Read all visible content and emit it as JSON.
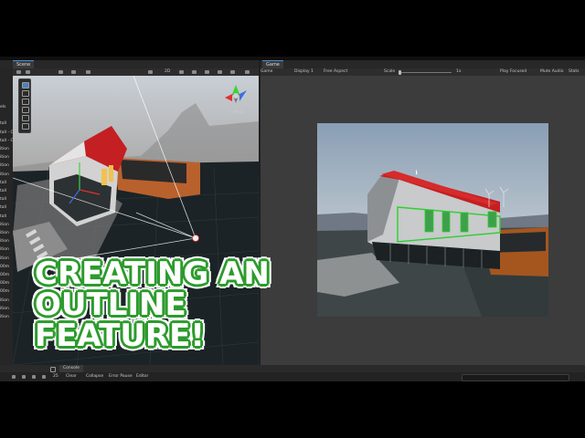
{
  "scene_tab": {
    "label": "Scene"
  },
  "game_tab": {
    "label": "Game"
  },
  "game_toolbar": {
    "mode": "Game",
    "display": "Display 1",
    "aspect": "Free Aspect",
    "scale_label": "Scale",
    "scale_value": "1x",
    "play_focused": "Play Focused",
    "mute_audio": "Mute Audio",
    "stats": "Stats"
  },
  "scene_toolbar": {
    "view_mode": "2D"
  },
  "gizmo": {
    "persp_label": "< Persp"
  },
  "hierarchy": {
    "items": [
      "els",
      "",
      "tall",
      "tall - Cu",
      "tall - Cu",
      "ition",
      "ition",
      "ition",
      "ition",
      "tall",
      "tall",
      "tall",
      "tall",
      "tall",
      "ition",
      "ition",
      "ition",
      "ition",
      "ition",
      "00m",
      "00m",
      "00m",
      "00m",
      "ition",
      "ition",
      "ition"
    ]
  },
  "console": {
    "tab_label": "Console",
    "clear_label": "Clear",
    "collapse_label": "Collapse",
    "error_pause_label": "Error Pause",
    "editor_label": "Editor",
    "count": "25"
  },
  "overlay": {
    "line1": "CREATING AN",
    "line2": "OUTLINE",
    "line3": "FEATURE!"
  },
  "colors": {
    "outline_green": "#2c9b2c",
    "roof_red": "#c41f22",
    "editor_bg": "#1f1f1f"
  }
}
